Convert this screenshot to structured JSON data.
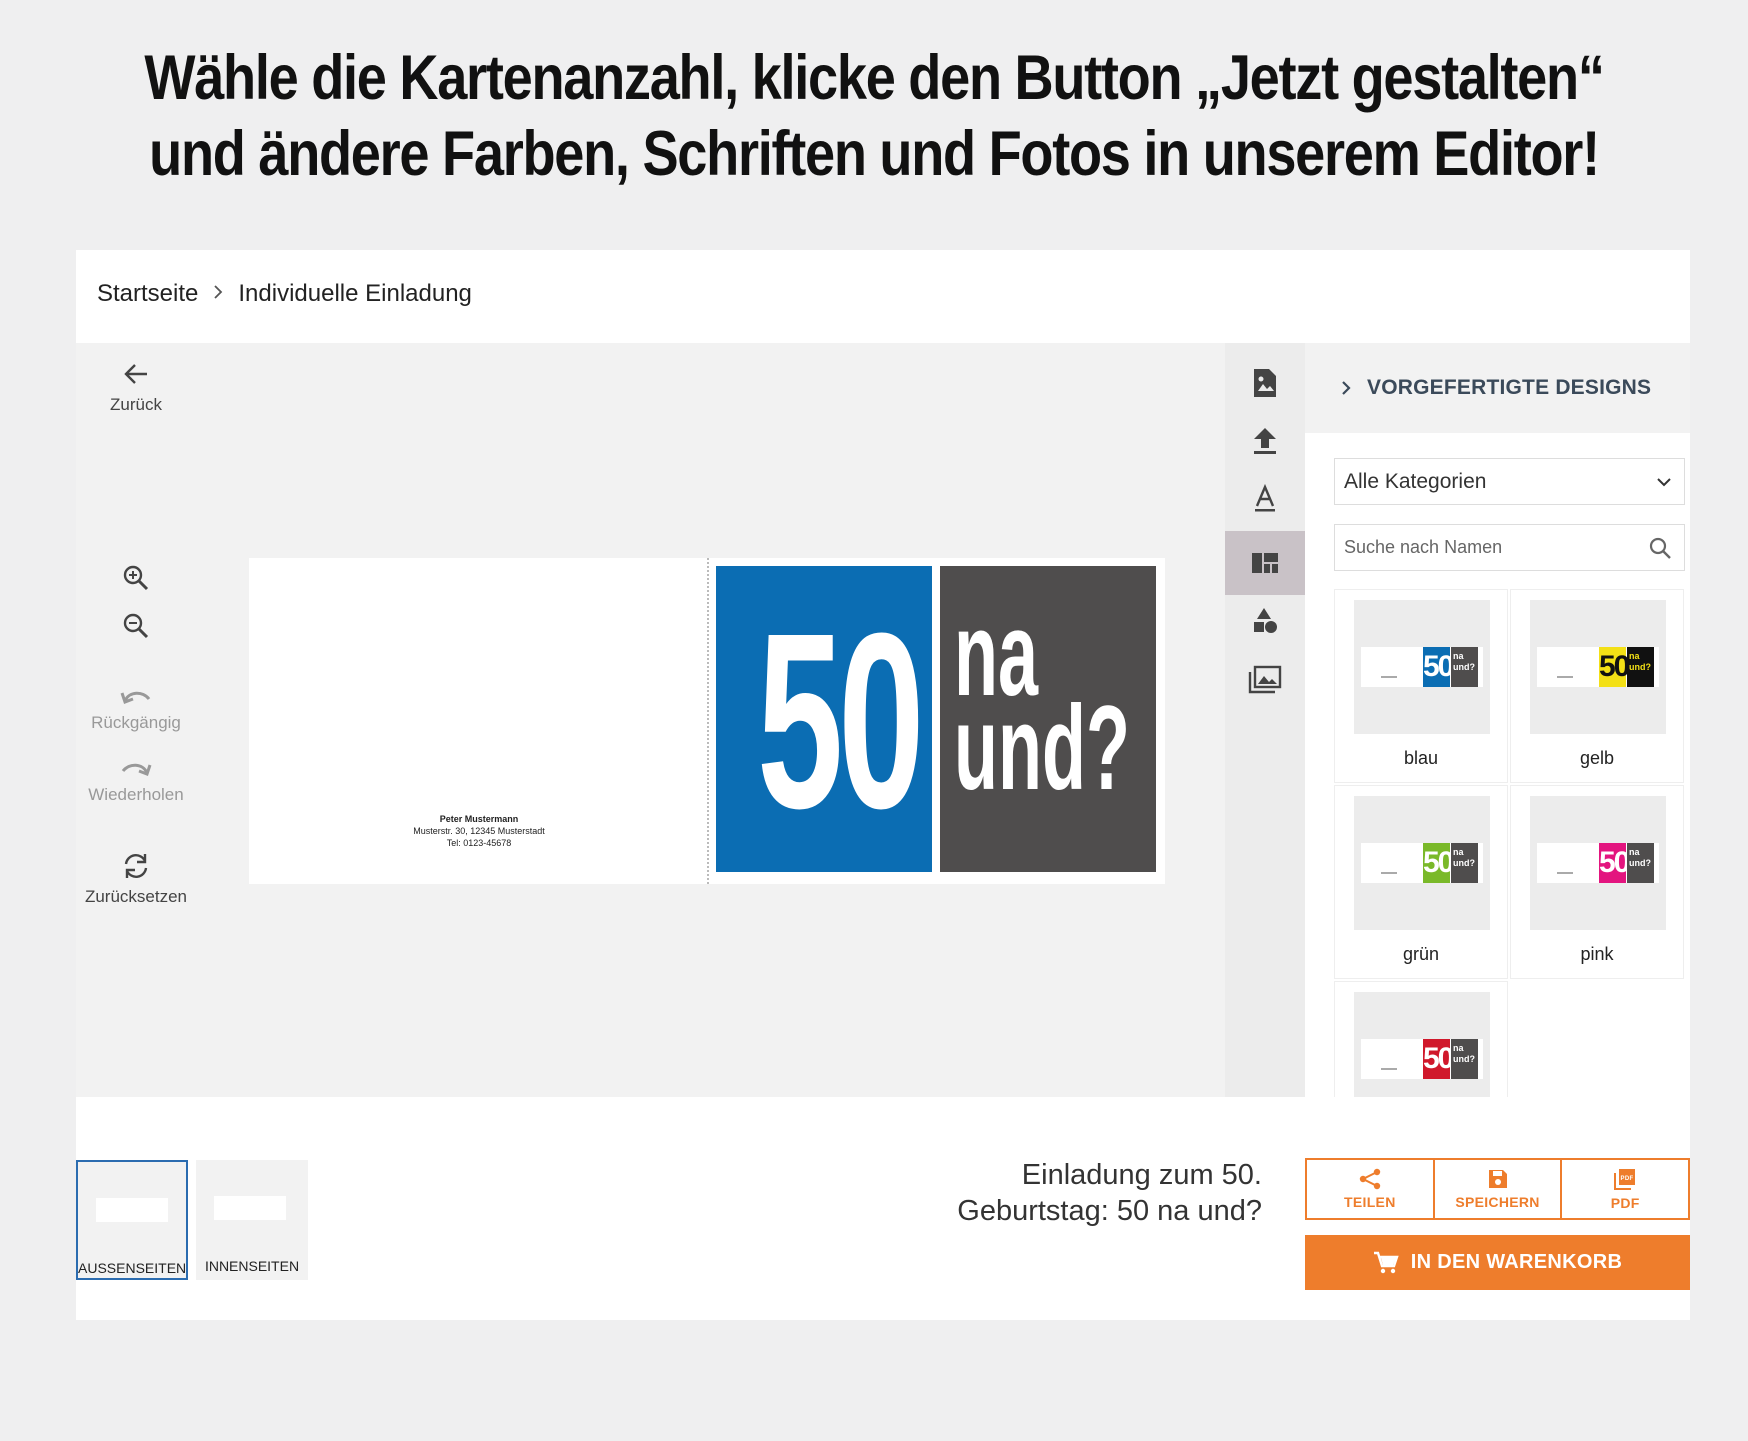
{
  "headline": {
    "line1": "Wähle die Kartenanzahl, klicke den Button „Jetzt gestalten“",
    "line2": "und ändere Farben, Schriften und Fotos in unserem Editor!"
  },
  "breadcrumb": {
    "home": "Startseite",
    "separator": ">",
    "current": "Individuelle Einladung"
  },
  "tools": {
    "back": "Zurück",
    "undo": "Rückgängig",
    "redo": "Wiederholen",
    "reset": "Zurücksetzen"
  },
  "card": {
    "address_name": "Peter Mustermann",
    "address_street": "Musterstr. 30, 12345 Musterstadt",
    "address_phone": "Tel: 0123-45678",
    "big_number": "50",
    "line1": "na",
    "line2": "und?",
    "colors": {
      "blue": "#0b6db3",
      "gray": "#4f4d4d"
    }
  },
  "panel": {
    "title": "VORGEFERTIGTE DESIGNS",
    "category_select": "Alle Kategorien",
    "search_placeholder": "Suche nach Namen",
    "designs": [
      {
        "label": "blau",
        "color": "#0b6db3",
        "mini_50": "50",
        "mini_text": "na und?"
      },
      {
        "label": "gelb",
        "color": "#f3e016",
        "mini_50": "50",
        "mini_text": "na und?"
      },
      {
        "label": "grün",
        "color": "#7ab929",
        "mini_50": "50",
        "mini_text": "na und?"
      },
      {
        "label": "pink",
        "color": "#e3157f",
        "mini_50": "50",
        "mini_text": "na und?"
      },
      {
        "label": "",
        "color": "#d0182b",
        "mini_50": "50",
        "mini_text": "na und?"
      }
    ]
  },
  "pages": {
    "outer": "AUSSENSEITEN",
    "inner": "INNENSEITEN"
  },
  "product": {
    "title_line1": "Einladung zum 50.",
    "title_line2": "Geburtstag: 50 na und?"
  },
  "actions": {
    "share": "TEILEN",
    "save": "SPEICHERN",
    "pdf": "PDF",
    "cart": "IN DEN WARENKORB",
    "accent": "#ee7d2c"
  }
}
